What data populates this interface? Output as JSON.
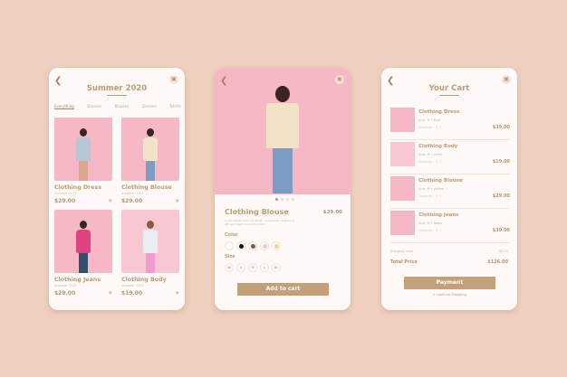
{
  "catalog": {
    "title": "Summer 2020",
    "tabs": [
      "Everything",
      "Dresses",
      "Blouses",
      "Dresses",
      "Tshirts"
    ],
    "products": [
      {
        "name": "Clothing Dress",
        "subtitle": "Summer 2020",
        "price": "$29.00"
      },
      {
        "name": "Clothing Blouse",
        "subtitle": "Summer 2020",
        "price": "$29.00"
      },
      {
        "name": "Clothing Jeans",
        "subtitle": "Summer 2020",
        "price": "$29.00"
      },
      {
        "name": "Clothing Body",
        "subtitle": "Summer 2020",
        "price": "$19.00"
      }
    ]
  },
  "detail": {
    "name": "Clothing Blouse",
    "price": "$29.00",
    "description": "Lorem ipsum dolor sit amet, consectetur adipiscing elit, sed diam nonummy nibh.",
    "color_label": "Color",
    "colors": [
      "#ffffff",
      "#111111",
      "#8a5a3c",
      "#f7c3d3",
      "#f3d38f"
    ],
    "size_label": "Size",
    "sizes": [
      "XS",
      "S",
      "M",
      "L",
      "XL"
    ],
    "add_button": "Add to cart"
  },
  "cart": {
    "title": "Your Cart",
    "items": [
      {
        "name": "Clothing Dress",
        "size": "Size: M • blue",
        "qty": "Quantity: - 1 +",
        "price": "$39.00"
      },
      {
        "name": "Clothing Body",
        "size": "Size: M • white",
        "qty": "Quantity: - 1 +",
        "price": "$19.00"
      },
      {
        "name": "Clothing Blouse",
        "size": "Size: M • yellow",
        "qty": "Quantity: - 1 +",
        "price": "$29.00"
      },
      {
        "name": "Clothing Jeans",
        "size": "Size: M • jeans",
        "qty": "Quantity: - 1 +",
        "price": "$39.00"
      }
    ],
    "shipping_label": "Shipping costs",
    "shipping": "$0.00",
    "total_label": "Total Price",
    "total": "$126.00",
    "payment_button": "Payment",
    "continue_link": "< Continue Shopping"
  },
  "colors": {
    "accent": "#c4a07a",
    "background": "#efcfbf",
    "photo": "#f6b8c4"
  }
}
